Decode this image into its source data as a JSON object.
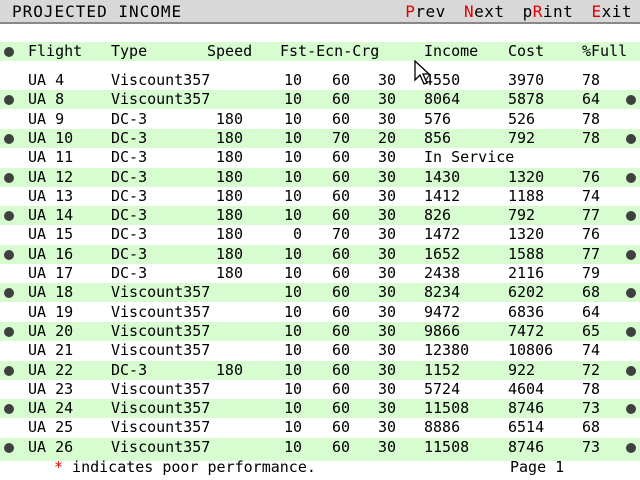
{
  "title": "PROJECTED INCOME",
  "menu": [
    {
      "hot": "P",
      "rest": "rev"
    },
    {
      "hot": "N",
      "rest": "ext"
    },
    {
      "pre": "p",
      "hot": "R",
      "rest": "int"
    },
    {
      "hot": "E",
      "rest": "xit"
    }
  ],
  "headers": {
    "flight": "Flight",
    "type": "Type",
    "speed": "Speed",
    "fec": "Fst-Ecn-Crg",
    "income": "Income",
    "cost": "Cost",
    "full": "%Full"
  },
  "rows": [
    {
      "flight": "UA 4",
      "type": "Viscount357",
      "speed": "",
      "fst": "10",
      "ecn": "60",
      "crg": "30",
      "income": "4550",
      "cost": "3970",
      "full": "78"
    },
    {
      "flight": "UA 8",
      "type": "Viscount357",
      "speed": "",
      "fst": "10",
      "ecn": "60",
      "crg": "30",
      "income": "8064",
      "cost": "5878",
      "full": "64"
    },
    {
      "flight": "UA 9",
      "type": "DC-3",
      "speed": "180",
      "fst": "10",
      "ecn": "60",
      "crg": "30",
      "income": "576",
      "cost": "526",
      "full": "78"
    },
    {
      "flight": "UA 10",
      "type": "DC-3",
      "speed": "180",
      "fst": "10",
      "ecn": "70",
      "crg": "20",
      "income": "856",
      "cost": "792",
      "full": "78"
    },
    {
      "flight": "UA 11",
      "type": "DC-3",
      "speed": "180",
      "fst": "10",
      "ecn": "60",
      "crg": "30",
      "income": "In Service",
      "cost": "",
      "full": ""
    },
    {
      "flight": "UA 12",
      "type": "DC-3",
      "speed": "180",
      "fst": "10",
      "ecn": "60",
      "crg": "30",
      "income": "1430",
      "cost": "1320",
      "full": "76"
    },
    {
      "flight": "UA 13",
      "type": "DC-3",
      "speed": "180",
      "fst": "10",
      "ecn": "60",
      "crg": "30",
      "income": "1412",
      "cost": "1188",
      "full": "74"
    },
    {
      "flight": "UA 14",
      "type": "DC-3",
      "speed": "180",
      "fst": "10",
      "ecn": "60",
      "crg": "30",
      "income": "826",
      "cost": "792",
      "full": "77"
    },
    {
      "flight": "UA 15",
      "type": "DC-3",
      "speed": "180",
      "fst": "0",
      "ecn": "70",
      "crg": "30",
      "income": "1472",
      "cost": "1320",
      "full": "76"
    },
    {
      "flight": "UA 16",
      "type": "DC-3",
      "speed": "180",
      "fst": "10",
      "ecn": "60",
      "crg": "30",
      "income": "1652",
      "cost": "1588",
      "full": "77"
    },
    {
      "flight": "UA 17",
      "type": "DC-3",
      "speed": "180",
      "fst": "10",
      "ecn": "60",
      "crg": "30",
      "income": "2438",
      "cost": "2116",
      "full": "79"
    },
    {
      "flight": "UA 18",
      "type": "Viscount357",
      "speed": "",
      "fst": "10",
      "ecn": "60",
      "crg": "30",
      "income": "8234",
      "cost": "6202",
      "full": "68"
    },
    {
      "flight": "UA 19",
      "type": "Viscount357",
      "speed": "",
      "fst": "10",
      "ecn": "60",
      "crg": "30",
      "income": "9472",
      "cost": "6836",
      "full": "64"
    },
    {
      "flight": "UA 20",
      "type": "Viscount357",
      "speed": "",
      "fst": "10",
      "ecn": "60",
      "crg": "30",
      "income": "9866",
      "cost": "7472",
      "full": "65"
    },
    {
      "flight": "UA 21",
      "type": "Viscount357",
      "speed": "",
      "fst": "10",
      "ecn": "60",
      "crg": "30",
      "income": "12380",
      "cost": "10806",
      "full": "74"
    },
    {
      "flight": "UA 22",
      "type": "DC-3",
      "speed": "180",
      "fst": "10",
      "ecn": "60",
      "crg": "30",
      "income": "1152",
      "cost": "922",
      "full": "72"
    },
    {
      "flight": "UA 23",
      "type": "Viscount357",
      "speed": "",
      "fst": "10",
      "ecn": "60",
      "crg": "30",
      "income": "5724",
      "cost": "4604",
      "full": "78"
    },
    {
      "flight": "UA 24",
      "type": "Viscount357",
      "speed": "",
      "fst": "10",
      "ecn": "60",
      "crg": "30",
      "income": "11508",
      "cost": "8746",
      "full": "73"
    },
    {
      "flight": "UA 25",
      "type": "Viscount357",
      "speed": "",
      "fst": "10",
      "ecn": "60",
      "crg": "30",
      "income": "8886",
      "cost": "6514",
      "full": "68"
    },
    {
      "flight": "UA 26",
      "type": "Viscount357",
      "speed": "",
      "fst": "10",
      "ecn": "60",
      "crg": "30",
      "income": "11508",
      "cost": "8746",
      "full": "73"
    }
  ],
  "footer": {
    "star": "*",
    "note": " indicates poor performance.",
    "page": "Page 1"
  },
  "colors": {
    "stripe": "#d6fcd0",
    "accent": "#e00000"
  }
}
